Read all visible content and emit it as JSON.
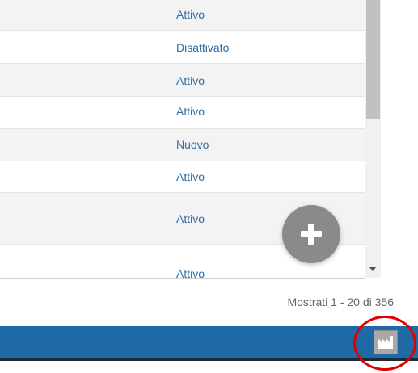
{
  "grid": {
    "rows": [
      {
        "status": "Attivo"
      },
      {
        "status": "Disattivato"
      },
      {
        "status": "Attivo"
      },
      {
        "status": "Attivo"
      },
      {
        "status": "Nuovo"
      },
      {
        "status": "Attivo"
      },
      {
        "status": "Attivo"
      },
      {
        "status": "Attivo"
      }
    ]
  },
  "pager": {
    "text": "Mostrati 1 - 20 di 356"
  },
  "fab": {
    "icon": "plus-icon"
  },
  "bottom_bar": {
    "button_icon": "factory-icon"
  },
  "annotation": {
    "color": "#e00000"
  },
  "colors": {
    "status_text": "#2e6ea6",
    "bar": "#1f6aa5",
    "fab": "#8a8a8a"
  }
}
